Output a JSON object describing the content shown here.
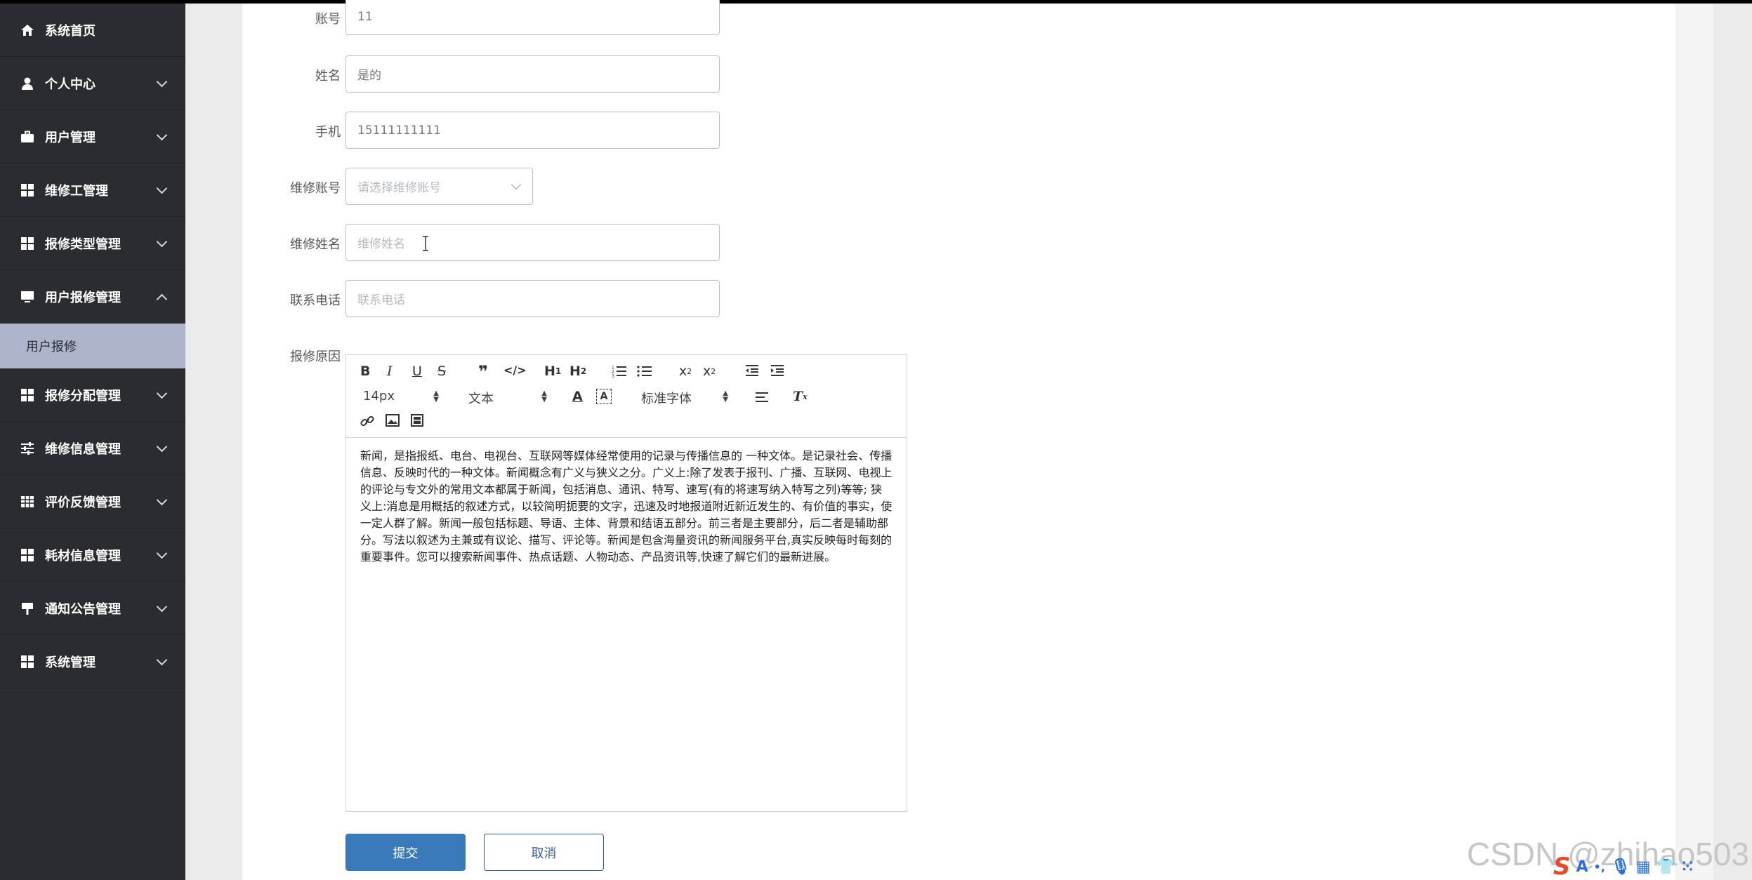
{
  "sidebar": {
    "items": [
      {
        "label": "系统首页",
        "icon": "home-icon"
      },
      {
        "label": "个人中心",
        "icon": "user-icon"
      },
      {
        "label": "用户管理",
        "icon": "briefcase-icon"
      },
      {
        "label": "维修工管理",
        "icon": "grid-icon"
      },
      {
        "label": "报修类型管理",
        "icon": "grid-icon"
      },
      {
        "label": "用户报修管理",
        "icon": "monitor-icon",
        "expanded": true
      },
      {
        "label": "报修分配管理",
        "icon": "grid-icon"
      },
      {
        "label": "维修信息管理",
        "icon": "sliders-icon"
      },
      {
        "label": "评价反馈管理",
        "icon": "table-icon"
      },
      {
        "label": "耗材信息管理",
        "icon": "grid-icon"
      },
      {
        "label": "通知公告管理",
        "icon": "sign-icon"
      },
      {
        "label": "系统管理",
        "icon": "grid-icon"
      }
    ],
    "sub_item": "用户报修"
  },
  "form": {
    "account_label": "账号",
    "account_value": "11",
    "name_label": "姓名",
    "name_value": "是的",
    "phone_label": "手机",
    "phone_value": "15111111111",
    "repair_account_label": "维修账号",
    "repair_account_placeholder": "请选择维修账号",
    "repair_name_label": "维修姓名",
    "repair_name_placeholder": "维修姓名",
    "contact_label": "联系电话",
    "contact_placeholder": "联系电话",
    "reason_label": "报修原因"
  },
  "editor": {
    "font_size": "14px",
    "block_type": "文本",
    "font_family": "标准字体",
    "content": "新闻，是指报纸、电台、电视台、互联网等媒体经常使用的记录与传播信息的 一种文体。是记录社会、传播信息、反映时代的一种文体。新闻概念有广义与狭义之分。广义上:除了发表于报刊、广播、互联网、电视上的评论与专文外的常用文本都属于新闻，包括消息、通讯、特写、速写(有的将速写纳入特写之列)等等; 狭义上:消息是用概括的叙述方式，以较简明扼要的文字，迅速及时地报道附近新近发生的、有价值的事实，使一定人群了解。新闻一般包括标题、导语、主体、背景和结语五部分。前三者是主要部分，后二者是辅助部分。写法以叙述为主兼或有议论、描写、评论等。新闻是包含海量资讯的新闻服务平台,真实反映每时每刻的重要事件。您可以搜索新闻事件、热点话题、人物动态、产品资讯等,快速了解它们的最新进展。"
  },
  "buttons": {
    "submit": "提交",
    "cancel": "取消"
  },
  "watermark": "CSDN @zhihao503",
  "colors": {
    "sidebar_bg": "#2a2c2f",
    "submenu_bg": "#aeb4c9",
    "primary": "#3a7ab8"
  }
}
